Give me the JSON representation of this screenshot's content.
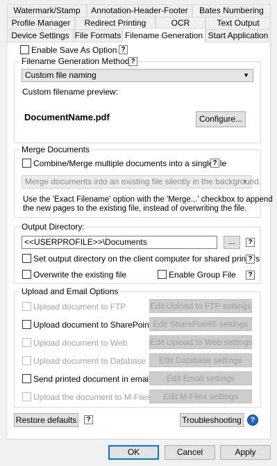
{
  "tabs": {
    "row1": [
      "Watermark/Stamp",
      "Annotation-Header-Footer",
      "Bates Numbering"
    ],
    "row2": [
      "Profile Manager",
      "Redirect Printing",
      "OCR",
      "Text Output"
    ],
    "row3": [
      "Device Settings",
      "File Formats",
      "Filename Generation",
      "Start Application"
    ],
    "active": "Filename Generation"
  },
  "enable_save_as": {
    "label": "Enable Save As Option",
    "checked": false
  },
  "filename_methods": {
    "title": "Filename Generation Methods",
    "selected": "Custom file naming",
    "preview_label": "Custom filename preview:",
    "preview_value": "DocumentName.pdf",
    "configure_label": "Configure..."
  },
  "merge": {
    "title": "Merge Documents",
    "checkbox_label": "Combine/Merge multiple documents into a single file",
    "checked": false,
    "mode_selected": "Merge documents into an existing file silently in the background.",
    "note": "Use the 'Exact Filename' option with the 'Merge...' checkbox to append the new pages to the existing file, instead of overwriting the file.",
    "note_line1": "Use the 'Exact Filename' option with the 'Merge...' checkbox to append",
    "note_line2": "the new pages to the existing file, instead of overwriting the file."
  },
  "output": {
    "title": "Output Directory:",
    "path": "<<USERPROFILE>>\\Documents",
    "browse_label": "...",
    "client_dir_label": "Set output directory on the client computer for shared printers",
    "overwrite_label": "Overwrite the existing file",
    "group_file_label": "Enable Group File"
  },
  "upload": {
    "title": "Upload and Email Options",
    "items": [
      {
        "label": "Upload document to FTP",
        "button": "Edit Upload to FTP settings",
        "enabled": false
      },
      {
        "label": "Upload document to SharePoint®",
        "button": "Edit SharePoint® settings",
        "enabled": true
      },
      {
        "label": "Upload document to Web",
        "button": "Edit Upload to Web settings",
        "enabled": false
      },
      {
        "label": "Upload document to Database",
        "button": "Edit Database settings",
        "enabled": false
      },
      {
        "label": "Send printed document in email",
        "button": "Edit Email settings",
        "enabled": true
      },
      {
        "label": "Upload the document to M-Files",
        "button": "Edit M-Files settings",
        "enabled": false
      }
    ]
  },
  "footer": {
    "restore_label": "Restore defaults",
    "troubleshooting_label": "Troubleshooting",
    "ok_label": "OK",
    "cancel_label": "Cancel",
    "apply_label": "Apply"
  },
  "help_glyph": "?",
  "colors": {
    "accent": "#0078d7",
    "help_blue": "#1e63c7",
    "disabled_text": "#a0a0a0"
  }
}
